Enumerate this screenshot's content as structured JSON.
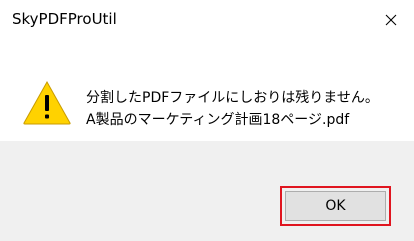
{
  "window": {
    "title": "SkyPDFProUtil",
    "close_glyph": "✕"
  },
  "message": {
    "icon": "warning-icon",
    "line1": "分割したPDFファイルにしおりは残りません。",
    "line2": "A製品のマーケティング計画18ページ.pdf"
  },
  "buttons": {
    "ok_label": "OK"
  },
  "colors": {
    "highlight_border": "#e0151f",
    "warning_fill": "#ffd200",
    "footer_bg": "#f0f0f0"
  }
}
